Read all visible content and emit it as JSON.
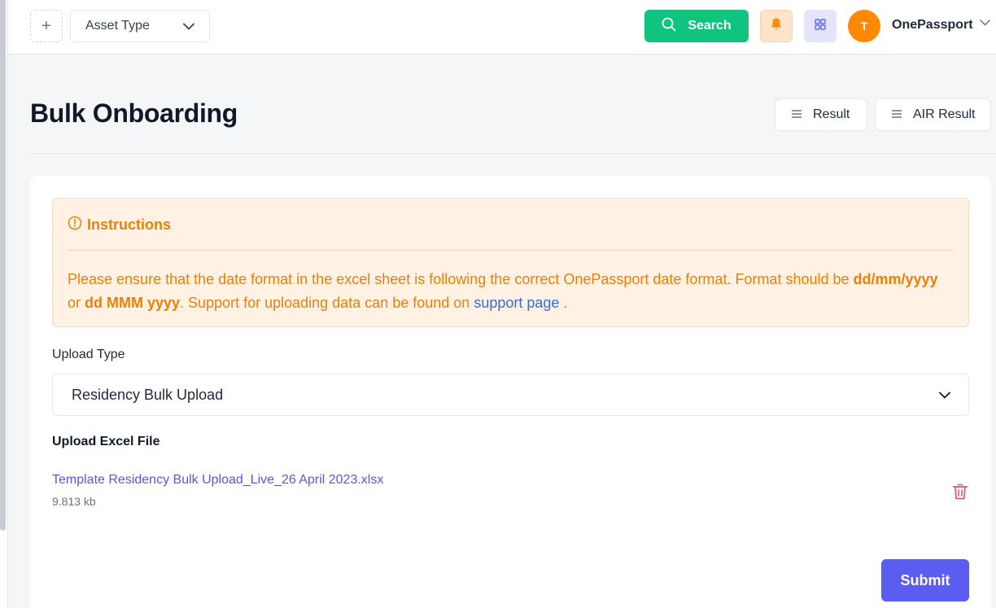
{
  "topbar": {
    "add_icon_glyph": "+",
    "asset_type_label": "Asset Type",
    "search_label": "Search",
    "user": {
      "initial": "T",
      "name": "OnePassport"
    }
  },
  "header": {
    "title": "Bulk Onboarding",
    "result_label": "Result",
    "air_result_label": "AIR Result"
  },
  "instructions": {
    "title": "Instructions",
    "text_part1": "Please ensure that the date format in the excel sheet is following the correct OnePassport date format. Format should be ",
    "format1": "dd/mm/yyyy",
    "or_text": " or ",
    "format2": "dd MMM yyyy",
    "text_part2": ". Support for uploading data can be found on ",
    "link_text": "support page",
    "text_end": " ."
  },
  "upload": {
    "type_label": "Upload Type",
    "type_value": "Residency Bulk Upload",
    "excel_label": "Upload Excel File",
    "file_name": "Template Residency Bulk Upload_Live_26 April 2023.xlsx",
    "file_size": "9.813 kb"
  },
  "actions": {
    "submit_label": "Submit"
  },
  "colors": {
    "search_green": "#10c37e",
    "avatar_orange": "#ff8a00",
    "instruction_orange": "#e8800a",
    "link_blue": "#2f6fde",
    "submit_purple": "#5b5cf0",
    "delete_red": "#f0476a"
  }
}
